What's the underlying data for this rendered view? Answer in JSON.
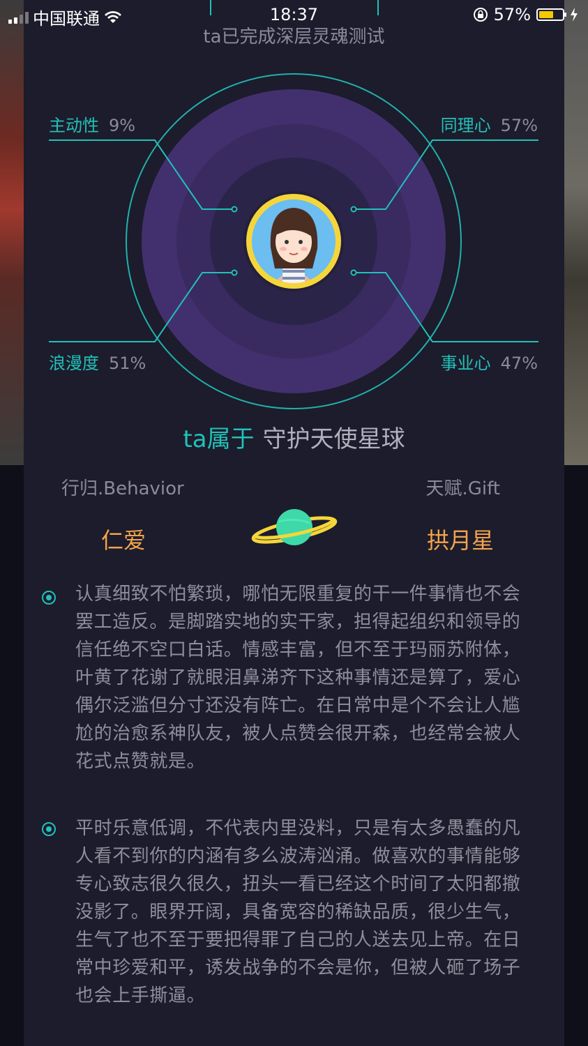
{
  "status_bar": {
    "carrier": "中国联通",
    "time": "18:37",
    "battery": "57%"
  },
  "header": {
    "subtitle": "ta已完成深层灵魂测试"
  },
  "traits": [
    {
      "name": "主动性",
      "percent": "9%"
    },
    {
      "name": "同理心",
      "percent": "57%"
    },
    {
      "name": "浪漫度",
      "percent": "51%"
    },
    {
      "name": "事业心",
      "percent": "47%"
    }
  ],
  "planet": {
    "prefix": "ta属于",
    "name": "守护天使星球"
  },
  "behavior": {
    "label": "行归.Behavior",
    "value": "仁爱"
  },
  "gift": {
    "label": "天赋.Gift",
    "value": "拱月星"
  },
  "descriptions": [
    "认真细致不怕繁琐，哪怕无限重复的干一件事情也不会罢工造反。是脚踏实地的实干家，担得起组织和领导的信任绝不空口白话。情感丰富，但不至于玛丽苏附体，叶黄了花谢了就眼泪鼻涕齐下这种事情还是算了，爱心偶尔泛滥但分寸还没有阵亡。在日常中是个不会让人尴尬的治愈系神队友，被人点赞会很开森，也经常会被人花式点赞就是。",
    "平时乐意低调，不代表内里没料，只是有太多愚蠢的凡人看不到你的内涵有多么波涛汹涌。做喜欢的事情能够专心致志很久很久，扭头一看已经这个时间了太阳都撤没影了。眼界开阔，具备宽容的稀缺品质，很少生气，生气了也不至于要把得罪了自己的人送去见上帝。在日常中珍爱和平，诱发战争的不会是你，但被人砸了场子也会上手撕逼。"
  ],
  "colors": {
    "accent": "#22c1b8",
    "orange": "#f5a34b",
    "avatar_ring": "#f5d63a",
    "planet": "#3ed9a8"
  }
}
